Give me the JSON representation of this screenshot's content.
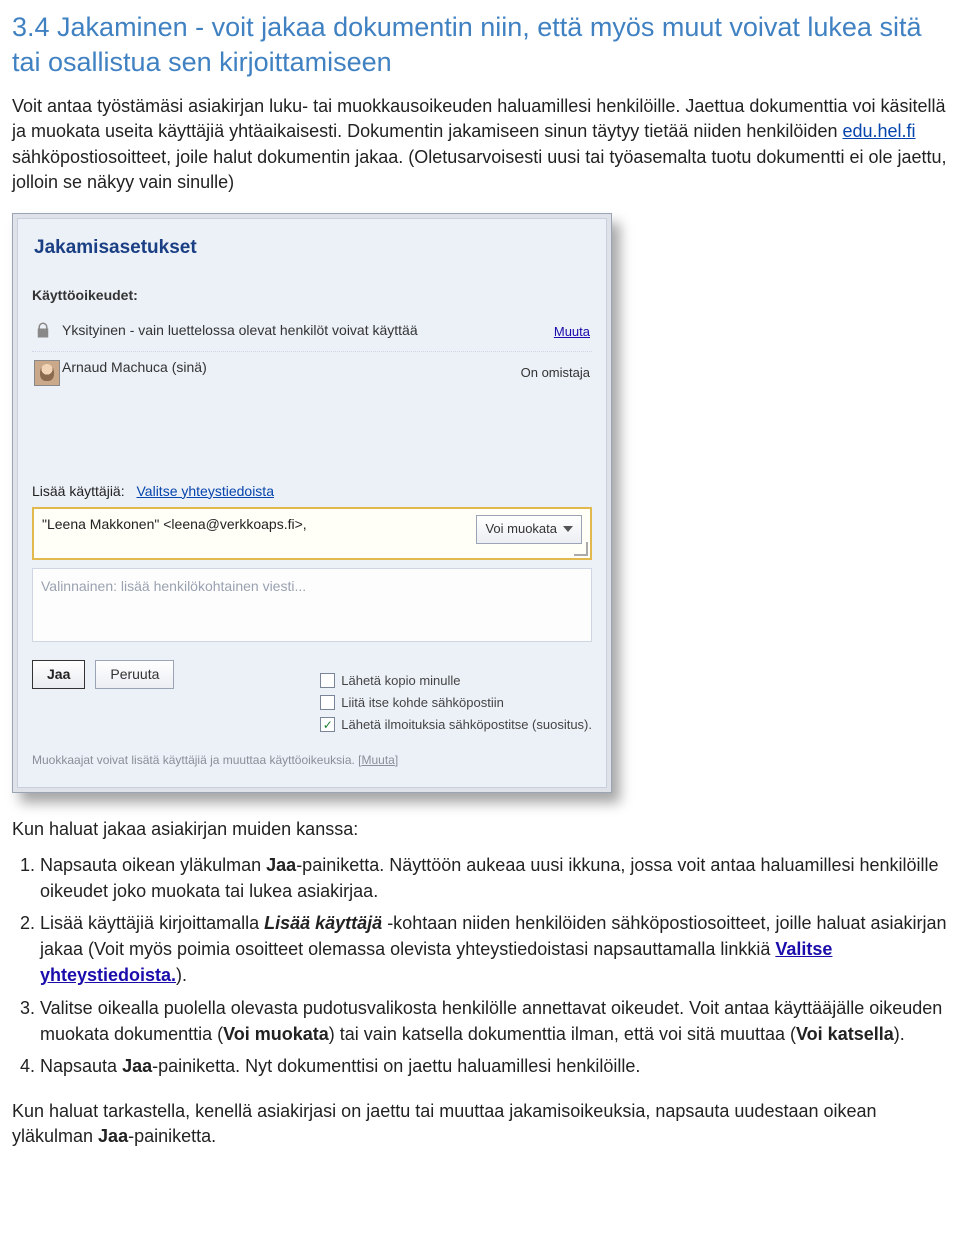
{
  "section": {
    "heading": "3.4 Jakaminen - voit jakaa dokumentin niin, että myös muut voivat lukea sitä tai osallistua sen kirjoittamiseen",
    "intro_1": "Voit antaa työstämäsi asiakirjan luku- tai muokkausoikeuden haluamillesi henkilöille. Jaettua dokumenttia voi käsitellä ja muokata useita käyttäjiä yhtäaikaisesti. Dokumentin jakamiseen sinun täytyy tietää niiden henkilöiden ",
    "intro_link": "edu.hel.fi",
    "intro_2": " sähköpostiosoitteet, joile halut dokumentin jakaa. (Oletusarvoisesti uusi tai työasemalta tuotu dokumentti ei ole jaettu, jolloin se näkyy vain sinulle)"
  },
  "dialog": {
    "title": "Jakamisasetukset",
    "permissions_label": "Käyttöoikeudet:",
    "row_private_text": "Yksityinen - vain luettelossa olevat henkilöt voivat käyttää",
    "row_private_action": "Muuta",
    "row_owner_name": "Arnaud Machuca (sinä)",
    "row_owner_status": "On omistaja",
    "add_label": "Lisää käyttäjiä:",
    "add_link": "Valitse yhteystiedoista",
    "add_value": "\"Leena Makkonen\" <leena@verkkoaps.fi>,",
    "perm_select": "Voi muokata",
    "message_placeholder": "Valinnainen: lisää henkilökohtainen viesti...",
    "opt_copy": "Lähetä kopio minulle",
    "opt_attach": "Liitä itse kohde sähköpostiin",
    "opt_notify": "Lähetä ilmoituksia sähköpostitse (suositus).",
    "btn_share": "Jaa",
    "btn_cancel": "Peruuta",
    "editors_note_1": "Muokkaajat voivat lisätä käyttäjiä ja muuttaa käyttöoikeuksia.  [",
    "editors_note_link": "Muuta",
    "editors_note_2": "]"
  },
  "post": {
    "lead": "Kun haluat jakaa asiakirjan muiden kanssa:",
    "steps": [
      {
        "pre": "Napsauta oikean yläkulman ",
        "b1": "Jaa",
        "post": "-painiketta. Näyttöön aukeaa uusi ikkuna, jossa voit antaa haluamillesi henkilöille oikeudet joko muokata tai lukea asiakirjaa."
      },
      {
        "pre": "Lisää käyttäjiä kirjoittamalla ",
        "b1": "Lisää käyttäjä",
        "mid": " -kohtaan niiden henkilöiden sähköpostiosoitteet, joille haluat asiakirjan jakaa (Voit myös poimia osoitteet olemassa olevista yhteystiedoistasi napsauttamalla linkkiä ",
        "link": "Valitse yhteystiedoista.",
        "post": ")."
      },
      {
        "pre": "Valitse oikealla puolella olevasta pudotusvalikosta henkilölle annettavat oikeudet. Voit antaa käyttääjälle oikeuden muokata dokumenttia (",
        "b1": "Voi muokata",
        "mid": ") tai vain katsella dokumenttia ilman, että voi sitä muuttaa (",
        "b2": "Voi katsella",
        "post": ")."
      },
      {
        "pre": "Napsauta ",
        "b1": "Jaa",
        "post": "-painiketta. Nyt dokumenttisi on jaettu haluamillesi henkilöille."
      }
    ],
    "footer_1": "Kun haluat tarkastella, kenellä asiakirjasi on jaettu tai muuttaa jakamisoikeuksia, napsauta uudestaan oikean yläkulman ",
    "footer_b": "Jaa",
    "footer_2": "-painiketta."
  }
}
